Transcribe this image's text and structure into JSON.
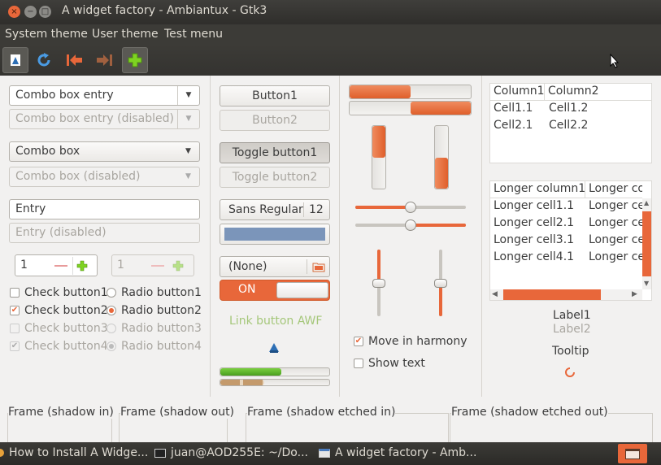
{
  "window": {
    "title": "A widget factory - Ambiantux - Gtk3",
    "close_glyph": "×",
    "min_glyph": "−",
    "max_glyph": "□"
  },
  "menu": [
    "System theme",
    "User theme",
    "Test menu"
  ],
  "toolbar_icons": [
    "document-icon",
    "refresh-icon",
    "go-first-icon",
    "go-last-icon",
    "add-icon"
  ],
  "col1": {
    "combo_entry": "Combo box entry",
    "combo_entry_disabled": "Combo box entry (disabled)",
    "combo_box": "Combo box",
    "combo_box_disabled": "Combo box (disabled)",
    "entry": "Entry",
    "entry_disabled": "Entry (disabled)",
    "spin1": "1",
    "spin2": "1",
    "check1": "Check button1",
    "check2": "Check button2",
    "check3": "Check button3",
    "check4": "Check button4",
    "radio1": "Radio button1",
    "radio2": "Radio button2",
    "radio3": "Radio button3",
    "radio4": "Radio button4"
  },
  "col2": {
    "button1": "Button1",
    "button2": "Button2",
    "toggle1": "Toggle button1",
    "toggle2": "Toggle button2",
    "font_name": "Sans Regular",
    "font_size": "12",
    "color_value": "#7b95ba",
    "file_chooser": "(None)",
    "switch_on": "ON",
    "link": "Link button AWF",
    "progress_green": 0.56,
    "progress_striped": 0.4
  },
  "col3": {
    "hprogress1": 0.5,
    "hprogress2": 0.5,
    "vprogress1": 0.5,
    "vprogress2": 0.5,
    "hscale1": 0.5,
    "hscale2": 0.5,
    "vscale1": 0.5,
    "vscale2": 0.5,
    "move_harmony": "Move in harmony",
    "show_text": "Show text"
  },
  "col4": {
    "tree1": {
      "headers": [
        "Column1",
        "Column2"
      ],
      "rows": [
        [
          "Cell1.1",
          "Cell1.2"
        ],
        [
          "Cell2.1",
          "Cell2.2"
        ]
      ]
    },
    "tree2": {
      "headers": [
        "Longer column1",
        "Longer co"
      ],
      "rows": [
        [
          "Longer cell1.1",
          "Longer ce"
        ],
        [
          "Longer cell2.1",
          "Longer ce"
        ],
        [
          "Longer cell3.1",
          "Longer ce"
        ],
        [
          "Longer cell4.1",
          "Longer ce"
        ]
      ]
    },
    "label1": "Label1",
    "label2": "Label2",
    "tooltip": "Tooltip"
  },
  "frames": [
    "Frame (shadow in)",
    "Frame (shadow out)",
    "Frame (shadow etched in)",
    "Frame (shadow etched out)"
  ],
  "taskbar": [
    "How to Install A Widge...",
    "juan@AOD255E: ~/Do...",
    "A widget factory - Amb..."
  ],
  "colors": {
    "accent": "#e8673a",
    "panel": "#3c3b37",
    "bg": "#f2f1f0",
    "progress_green": "#5fb82f"
  }
}
